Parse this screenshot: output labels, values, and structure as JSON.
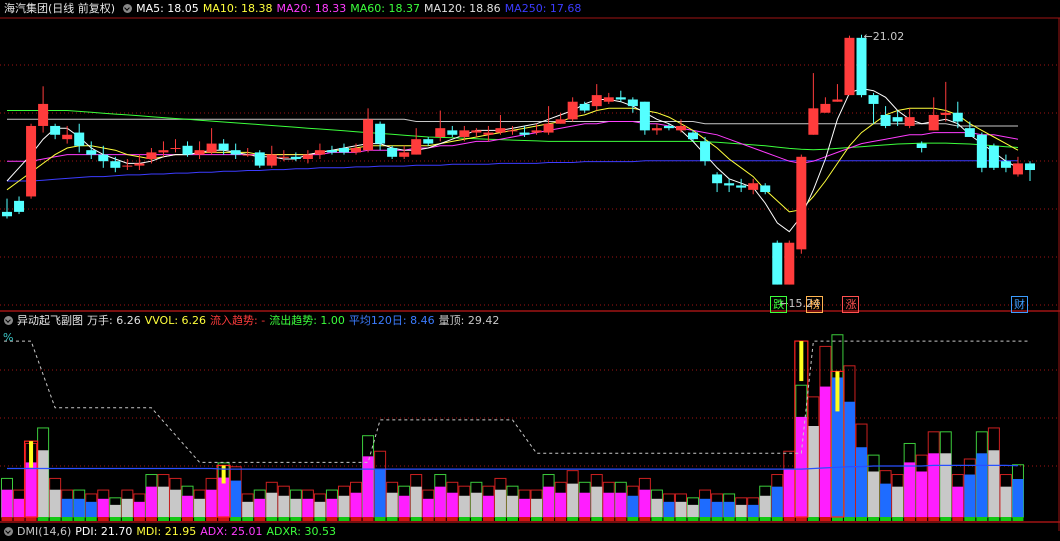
{
  "header": {
    "stock_title": "海汽集团(日线 前复权)",
    "ma": [
      {
        "label": "MA5: 18.05",
        "color": "#ffffff"
      },
      {
        "label": "MA10: 18.38",
        "color": "#ffff3c"
      },
      {
        "label": "MA20: 18.33",
        "color": "#ff3cff"
      },
      {
        "label": "MA60: 18.37",
        "color": "#3cff3c"
      },
      {
        "label": "MA120: 18.86",
        "color": "#e0e0e0"
      },
      {
        "label": "MA250: 17.68",
        "color": "#3c3cff"
      }
    ]
  },
  "price_chart": {
    "high_label": "21.02",
    "low_label": "15.24",
    "markers": [
      {
        "text": "跌",
        "color": "#3cff3c"
      },
      {
        "text": "榜",
        "color": "#ffb450"
      },
      {
        "text": "涨",
        "color": "#ff5050"
      },
      {
        "text": "财",
        "color": "#3c9cff"
      }
    ],
    "colors": {
      "up": "#ff3c3c",
      "down": "#54ffff",
      "ma5": "#ffffff",
      "ma10": "#ffff3c",
      "ma20": "#ff3cff",
      "ma60": "#3cff3c",
      "ma120": "#c8c8c8",
      "ma250": "#3c3cff",
      "grid": "#a01414"
    }
  },
  "indicator": {
    "name": "异动起飞副图",
    "stats": [
      {
        "label": "万手: 6.26",
        "color": "#e0e0e0"
      },
      {
        "label": "VVOL: 6.26",
        "color": "#ffff3c"
      },
      {
        "label": "流入趋势: -",
        "color": "#ff3c3c"
      },
      {
        "label": "流出趋势: 1.00",
        "color": "#3cff3c"
      },
      {
        "label": "平均120日: 8.46",
        "color": "#3c7cff"
      },
      {
        "label": "量顶: 29.42",
        "color": "#c8c8c8"
      }
    ],
    "unit": "%"
  },
  "bottom_indicator": {
    "stats": [
      {
        "label": "DMI(14,6)",
        "color": "#c8c8c8"
      },
      {
        "label": "PDI: 21.70",
        "color": "#ffffff"
      },
      {
        "label": "MDI: 21.95",
        "color": "#ffff3c"
      },
      {
        "label": "ADX: 25.01",
        "color": "#ff3cff"
      },
      {
        "label": "ADXR: 30.53",
        "color": "#3cff3c"
      }
    ]
  },
  "chart_data": {
    "type": "candlestick",
    "y_range": [
      15.0,
      21.4
    ],
    "candles": [
      [
        17.0,
        16.9,
        17.3,
        16.85
      ],
      [
        17.25,
        17.0,
        17.35,
        16.95
      ],
      [
        17.35,
        18.95,
        19.0,
        17.3
      ],
      [
        18.95,
        19.45,
        19.85,
        18.8
      ],
      [
        18.95,
        18.75,
        19.0,
        18.65
      ],
      [
        18.65,
        18.75,
        18.95,
        18.55
      ],
      [
        18.8,
        18.5,
        19.0,
        18.35
      ],
      [
        18.4,
        18.3,
        18.6,
        18.2
      ],
      [
        18.3,
        18.15,
        18.5,
        18.0
      ],
      [
        18.15,
        18.0,
        18.25,
        17.9
      ],
      [
        18.05,
        18.05,
        18.2,
        17.95
      ],
      [
        18.05,
        18.1,
        18.3,
        17.95
      ],
      [
        18.2,
        18.35,
        18.45,
        18.1
      ],
      [
        18.35,
        18.4,
        18.6,
        18.25
      ],
      [
        18.45,
        18.45,
        18.65,
        18.35
      ],
      [
        18.5,
        18.3,
        18.6,
        18.25
      ],
      [
        18.3,
        18.4,
        18.6,
        18.2
      ],
      [
        18.35,
        18.55,
        18.9,
        18.3
      ],
      [
        18.55,
        18.4,
        18.65,
        18.3
      ],
      [
        18.4,
        18.3,
        18.55,
        18.2
      ],
      [
        18.3,
        18.3,
        18.45,
        18.25
      ],
      [
        18.35,
        18.05,
        18.4,
        18.0
      ],
      [
        18.05,
        18.3,
        18.5,
        18.0
      ],
      [
        18.25,
        18.25,
        18.4,
        18.15
      ],
      [
        18.25,
        18.2,
        18.35,
        18.15
      ],
      [
        18.2,
        18.3,
        18.4,
        18.1
      ],
      [
        18.3,
        18.4,
        18.55,
        18.2
      ],
      [
        18.4,
        18.35,
        18.5,
        18.3
      ],
      [
        18.45,
        18.35,
        18.55,
        18.3
      ],
      [
        18.35,
        18.45,
        18.55,
        18.3
      ],
      [
        18.4,
        19.1,
        19.35,
        18.35
      ],
      [
        19.0,
        18.55,
        19.05,
        18.4
      ],
      [
        18.45,
        18.25,
        18.5,
        18.2
      ],
      [
        18.25,
        18.35,
        18.5,
        18.2
      ],
      [
        18.3,
        18.65,
        18.9,
        18.3
      ],
      [
        18.65,
        18.55,
        18.7,
        18.5
      ],
      [
        18.7,
        18.9,
        19.3,
        18.6
      ],
      [
        18.85,
        18.75,
        18.95,
        18.7
      ],
      [
        18.7,
        18.85,
        18.95,
        18.6
      ],
      [
        18.8,
        18.85,
        18.9,
        18.7
      ],
      [
        18.75,
        18.8,
        18.95,
        18.6
      ],
      [
        18.8,
        18.9,
        19.2,
        18.75
      ],
      [
        18.85,
        18.85,
        18.95,
        18.75
      ],
      [
        18.8,
        18.75,
        18.95,
        18.7
      ],
      [
        18.8,
        18.85,
        19.0,
        18.75
      ],
      [
        18.8,
        19.0,
        19.4,
        18.75
      ],
      [
        19.0,
        19.1,
        19.25,
        19.0
      ],
      [
        19.1,
        19.5,
        19.6,
        19.05
      ],
      [
        19.45,
        19.3,
        19.5,
        19.25
      ],
      [
        19.4,
        19.65,
        19.9,
        19.3
      ],
      [
        19.5,
        19.6,
        19.7,
        19.45
      ],
      [
        19.6,
        19.55,
        19.75,
        19.5
      ],
      [
        19.55,
        19.4,
        19.6,
        19.25
      ],
      [
        19.5,
        18.85,
        19.5,
        18.75
      ],
      [
        18.85,
        18.9,
        19.0,
        18.75
      ],
      [
        18.95,
        18.9,
        19.0,
        18.85
      ],
      [
        18.85,
        18.95,
        19.1,
        18.8
      ],
      [
        18.8,
        18.65,
        18.85,
        18.6
      ],
      [
        18.6,
        18.15,
        18.7,
        18.05
      ],
      [
        17.85,
        17.65,
        17.9,
        17.45
      ],
      [
        17.65,
        17.6,
        17.75,
        17.45
      ],
      [
        17.6,
        17.55,
        17.75,
        17.45
      ],
      [
        17.5,
        17.65,
        17.75,
        17.4
      ],
      [
        17.6,
        17.45,
        17.65,
        17.4
      ],
      [
        16.3,
        15.35,
        16.35,
        15.35
      ],
      [
        15.35,
        16.3,
        16.35,
        15.35
      ],
      [
        16.15,
        18.25,
        18.3,
        16.05
      ],
      [
        18.75,
        19.35,
        20.15,
        18.75
      ],
      [
        19.25,
        19.45,
        19.6,
        19.25
      ],
      [
        19.5,
        19.55,
        19.9,
        19.5
      ],
      [
        19.65,
        20.95,
        21.0,
        19.65
      ],
      [
        20.95,
        19.65,
        21.02,
        19.6
      ],
      [
        19.65,
        19.45,
        19.7,
        19.0
      ],
      [
        19.2,
        18.95,
        19.4,
        18.9
      ],
      [
        19.15,
        19.05,
        19.3,
        18.95
      ],
      [
        18.95,
        19.15,
        19.35,
        18.9
      ],
      [
        18.55,
        18.45,
        18.6,
        18.35
      ],
      [
        18.85,
        19.2,
        19.6,
        18.85
      ],
      [
        19.2,
        19.25,
        19.95,
        19.05
      ],
      [
        19.25,
        19.05,
        19.5,
        18.9
      ],
      [
        18.9,
        18.7,
        19.05,
        18.7
      ],
      [
        18.75,
        18.0,
        18.8,
        17.9
      ],
      [
        18.5,
        18.0,
        18.55,
        17.95
      ],
      [
        18.15,
        18.0,
        18.3,
        17.9
      ],
      [
        17.85,
        18.1,
        18.25,
        17.8
      ],
      [
        18.1,
        17.95,
        18.15,
        17.7
      ]
    ],
    "candle_comment": "each candle is [open, close, high, low] in price units",
    "ma5": [
      17.7,
      18.0,
      18.3,
      18.65,
      18.9,
      18.9,
      18.7,
      18.45,
      18.3,
      18.2,
      18.1,
      18.1,
      18.15,
      18.25,
      18.3,
      18.3,
      18.35,
      18.4,
      18.4,
      18.35,
      18.3,
      18.25,
      18.25,
      18.2,
      18.2,
      18.3,
      18.35,
      18.4,
      18.45,
      18.5,
      18.55,
      18.55,
      18.45,
      18.4,
      18.4,
      18.45,
      18.55,
      18.65,
      18.75,
      18.85,
      18.85,
      18.85,
      18.9,
      18.95,
      19.0,
      19.1,
      19.2,
      19.3,
      19.45,
      19.55,
      19.55,
      19.5,
      19.4,
      19.25,
      19.1,
      19.0,
      18.85,
      18.6,
      18.3,
      18.0,
      17.75,
      17.65,
      17.55,
      17.2,
      16.75,
      16.55,
      16.9,
      17.5,
      18.2,
      19.1,
      19.7,
      19.8,
      19.75,
      19.6,
      19.3,
      19.1,
      19.0,
      19.05,
      19.1,
      19.0,
      18.75,
      18.55,
      18.35,
      18.15,
      18.0
    ],
    "ma10": [
      17.5,
      17.7,
      17.9,
      18.1,
      18.3,
      18.45,
      18.5,
      18.5,
      18.45,
      18.4,
      18.3,
      18.25,
      18.2,
      18.25,
      18.3,
      18.3,
      18.35,
      18.35,
      18.35,
      18.35,
      18.35,
      18.3,
      18.3,
      18.3,
      18.3,
      18.3,
      18.35,
      18.4,
      18.4,
      18.45,
      18.5,
      18.5,
      18.5,
      18.5,
      18.5,
      18.5,
      18.55,
      18.6,
      18.65,
      18.7,
      18.75,
      18.8,
      18.85,
      18.9,
      18.95,
      19.0,
      19.05,
      19.15,
      19.2,
      19.3,
      19.35,
      19.35,
      19.35,
      19.3,
      19.25,
      19.15,
      19.0,
      18.85,
      18.65,
      18.45,
      18.2,
      18.0,
      17.8,
      17.5,
      17.25,
      17.0,
      17.05,
      17.35,
      17.7,
      18.1,
      18.5,
      18.8,
      19.0,
      19.2,
      19.3,
      19.35,
      19.35,
      19.35,
      19.3,
      19.2,
      19.0,
      18.85,
      18.7,
      18.55,
      18.4
    ],
    "ma20": [
      18.15,
      18.15,
      18.15,
      18.2,
      18.25,
      18.3,
      18.3,
      18.3,
      18.3,
      18.3,
      18.3,
      18.3,
      18.3,
      18.3,
      18.3,
      18.3,
      18.3,
      18.3,
      18.3,
      18.3,
      18.3,
      18.3,
      18.3,
      18.3,
      18.3,
      18.3,
      18.3,
      18.35,
      18.35,
      18.35,
      18.4,
      18.4,
      18.4,
      18.4,
      18.45,
      18.45,
      18.5,
      18.5,
      18.55,
      18.6,
      18.6,
      18.65,
      18.7,
      18.75,
      18.8,
      18.85,
      18.9,
      18.95,
      19.0,
      19.0,
      19.05,
      19.05,
      19.05,
      19.0,
      19.0,
      18.95,
      18.9,
      18.85,
      18.8,
      18.75,
      18.65,
      18.55,
      18.45,
      18.35,
      18.25,
      18.15,
      18.1,
      18.15,
      18.25,
      18.35,
      18.45,
      18.55,
      18.6,
      18.65,
      18.7,
      18.75,
      18.75,
      18.8,
      18.8,
      18.8,
      18.8,
      18.75,
      18.75,
      18.7,
      18.65
    ],
    "ma60": [
      19.3,
      19.3,
      19.3,
      19.3,
      19.3,
      19.3,
      19.28,
      19.26,
      19.24,
      19.22,
      19.2,
      19.18,
      19.16,
      19.14,
      19.12,
      19.1,
      19.08,
      19.06,
      19.04,
      19.02,
      19.0,
      18.98,
      18.96,
      18.94,
      18.92,
      18.9,
      18.88,
      18.86,
      18.84,
      18.82,
      18.8,
      18.78,
      18.76,
      18.74,
      18.72,
      18.7,
      18.69,
      18.68,
      18.67,
      18.66,
      18.65,
      18.64,
      18.63,
      18.62,
      18.61,
      18.6,
      18.6,
      18.6,
      18.6,
      18.6,
      18.6,
      18.6,
      18.6,
      18.6,
      18.6,
      18.6,
      18.6,
      18.6,
      18.59,
      18.58,
      18.56,
      18.54,
      18.52,
      18.5,
      18.47,
      18.44,
      18.42,
      18.41,
      18.42,
      18.44,
      18.46,
      18.48,
      18.5,
      18.52,
      18.54,
      18.55,
      18.56,
      18.56,
      18.56,
      18.55,
      18.54,
      18.52,
      18.5,
      18.48,
      18.46
    ],
    "ma120": [
      19.1,
      19.1,
      19.1,
      19.1,
      19.1,
      19.1,
      19.1,
      19.1,
      19.1,
      19.1,
      19.1,
      19.1,
      19.1,
      19.1,
      19.1,
      19.1,
      19.1,
      19.1,
      19.1,
      19.1,
      19.1,
      19.1,
      19.1,
      19.1,
      19.1,
      19.1,
      19.1,
      19.1,
      19.1,
      19.1,
      19.1,
      19.1,
      19.1,
      19.1,
      19.05,
      19.05,
      19.05,
      19.05,
      19.05,
      19.05,
      19.05,
      19.05,
      19.05,
      19.05,
      19.05,
      19.05,
      19.05,
      19.05,
      19.05,
      19.05,
      19.05,
      19.05,
      19.05,
      19.05,
      19.05,
      19.05,
      19.05,
      19.05,
      19.0,
      19.0,
      19.0,
      19.0,
      19.0,
      19.0,
      19.0,
      19.0,
      19.0,
      19.0,
      19.0,
      19.0,
      19.0,
      19.0,
      19.0,
      19.0,
      19.0,
      19.0,
      19.0,
      19.0,
      19.0,
      18.95,
      18.95,
      18.95,
      18.95,
      18.95,
      18.95
    ],
    "ma250": [
      17.7,
      17.7,
      17.7,
      17.72,
      17.74,
      17.76,
      17.78,
      17.8,
      17.8,
      17.82,
      17.84,
      17.84,
      17.86,
      17.86,
      17.88,
      17.88,
      17.9,
      17.9,
      17.92,
      17.92,
      17.94,
      17.94,
      17.96,
      17.96,
      17.98,
      17.98,
      18.0,
      18.0,
      18.0,
      18.02,
      18.02,
      18.04,
      18.04,
      18.04,
      18.06,
      18.06,
      18.06,
      18.08,
      18.08,
      18.08,
      18.08,
      18.1,
      18.1,
      18.1,
      18.1,
      18.12,
      18.12,
      18.12,
      18.14,
      18.14,
      18.14,
      18.14,
      18.14,
      18.16,
      18.16,
      18.16,
      18.16,
      18.16,
      18.16,
      18.16,
      18.16,
      18.16,
      18.16,
      18.16,
      18.16,
      18.16,
      18.16,
      18.16,
      18.16,
      18.16,
      18.16,
      18.16,
      18.16,
      18.16,
      18.16,
      18.16,
      18.16,
      18.16,
      18.16,
      18.16,
      18.16,
      18.16,
      18.16,
      18.16,
      18.16
    ],
    "volume_range": [
      0,
      30
    ],
    "volume": [
      4.5,
      3.0,
      9.0,
      11.0,
      4.5,
      3.0,
      3.0,
      2.5,
      3.0,
      2.0,
      3.0,
      2.5,
      5.0,
      5.0,
      4.5,
      3.5,
      3.0,
      4.5,
      6.5,
      6.0,
      2.5,
      3.0,
      4.0,
      3.5,
      3.0,
      3.0,
      2.5,
      3.0,
      3.5,
      4.0,
      10.0,
      8.0,
      4.0,
      3.5,
      5.0,
      3.0,
      5.0,
      4.0,
      3.5,
      4.0,
      3.5,
      4.5,
      3.5,
      3.0,
      3.0,
      5.0,
      4.0,
      5.5,
      4.0,
      5.0,
      4.0,
      4.0,
      3.5,
      4.5,
      3.0,
      2.5,
      2.5,
      2.0,
      3.0,
      2.5,
      2.5,
      2.0,
      2.0,
      3.5,
      5.0,
      8.0,
      16.5,
      15.0,
      21.5,
      23.0,
      19.0,
      11.5,
      7.5,
      5.5,
      5.0,
      9.0,
      7.5,
      10.5,
      10.5,
      5.0,
      7.0,
      10.5,
      11.0,
      5.0,
      6.26
    ],
    "volume_style": [
      "m",
      "m",
      "m",
      "w",
      "w",
      "b",
      "b",
      "b",
      "m",
      "w",
      "w",
      "m",
      "m",
      "w",
      "w",
      "m",
      "w",
      "m",
      "m",
      "b",
      "w",
      "m",
      "w",
      "w",
      "w",
      "m",
      "w",
      "m",
      "w",
      "m",
      "m",
      "b",
      "w",
      "m",
      "w",
      "m",
      "m",
      "m",
      "w",
      "w",
      "m",
      "w",
      "w",
      "m",
      "w",
      "m",
      "m",
      "w",
      "m",
      "w",
      "m",
      "m",
      "b",
      "m",
      "w",
      "b",
      "w",
      "w",
      "b",
      "b",
      "b",
      "w",
      "b",
      "w",
      "b",
      "m",
      "m",
      "w",
      "m",
      "b",
      "b",
      "b",
      "w",
      "b",
      "w",
      "m",
      "m",
      "m",
      "w",
      "m",
      "b",
      "b",
      "w",
      "w",
      "b",
      "g"
    ],
    "volume_outline": [
      null,
      null,
      12.5,
      null,
      null,
      null,
      null,
      null,
      null,
      null,
      null,
      null,
      null,
      null,
      null,
      null,
      null,
      null,
      8.5,
      null,
      null,
      null,
      null,
      null,
      null,
      null,
      null,
      null,
      null,
      null,
      null,
      null,
      null,
      null,
      null,
      null,
      null,
      null,
      null,
      null,
      null,
      null,
      null,
      null,
      null,
      null,
      null,
      null,
      null,
      null,
      null,
      null,
      null,
      null,
      null,
      null,
      null,
      null,
      null,
      null,
      null,
      null,
      null,
      null,
      null,
      null,
      29.0,
      null,
      null,
      24.0,
      null,
      null,
      null,
      null,
      null,
      null,
      null,
      null,
      null,
      null,
      null,
      null,
      null,
      null,
      null
    ],
    "avg120": [
      8.0,
      8.0,
      8.0,
      8.0,
      8.0,
      8.0,
      8.0,
      8.0,
      8.0,
      8.0,
      8.0,
      8.0,
      8.0,
      8.0,
      8.0,
      8.0,
      8.0,
      8.0,
      7.9,
      7.9,
      7.9,
      7.9,
      7.9,
      7.9,
      7.9,
      7.9,
      7.9,
      7.9,
      7.9,
      7.9,
      7.9,
      7.9,
      7.9,
      7.9,
      7.9,
      7.9,
      7.9,
      7.9,
      7.9,
      7.9,
      7.9,
      7.9,
      7.9,
      7.9,
      7.9,
      7.9,
      7.9,
      7.9,
      7.9,
      7.9,
      7.9,
      7.9,
      7.9,
      7.9,
      7.9,
      7.9,
      7.9,
      7.9,
      7.9,
      7.9,
      7.9,
      7.9,
      7.9,
      7.9,
      7.9,
      7.9,
      7.9,
      8.0,
      8.1,
      8.2,
      8.3,
      8.3,
      8.4,
      8.4,
      8.4,
      8.4,
      8.4,
      8.5,
      8.5,
      8.5,
      8.5,
      8.5,
      8.5,
      8.5,
      8.46
    ]
  }
}
